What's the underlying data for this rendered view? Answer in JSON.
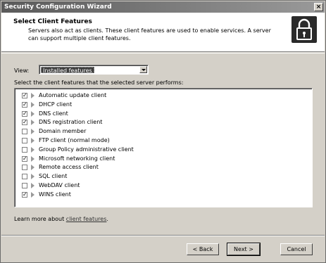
{
  "window": {
    "title": "Security Configuration Wizard",
    "close_label": "×"
  },
  "header": {
    "title": "Select Client Features",
    "description": "Servers also act as clients. These client features are used to enable services. A server can support multiple client features."
  },
  "view": {
    "label": "View:",
    "selected": "Installed features"
  },
  "list": {
    "caption": "Select the client features that the selected server performs:",
    "items": [
      {
        "label": "Automatic update client",
        "checked": true
      },
      {
        "label": "DHCP client",
        "checked": true
      },
      {
        "label": "DNS client",
        "checked": true
      },
      {
        "label": "DNS registration client",
        "checked": true
      },
      {
        "label": "Domain member",
        "checked": false
      },
      {
        "label": "FTP client (normal mode)",
        "checked": false
      },
      {
        "label": "Group Policy administrative client",
        "checked": false
      },
      {
        "label": "Microsoft networking client",
        "checked": true
      },
      {
        "label": "Remote access client",
        "checked": false
      },
      {
        "label": "SQL client",
        "checked": false
      },
      {
        "label": "WebDAV client",
        "checked": false
      },
      {
        "label": "WINS client",
        "checked": true
      }
    ]
  },
  "learn_more": {
    "prefix": "Learn more about ",
    "link": "client features",
    "suffix": "."
  },
  "buttons": {
    "back": "< Back",
    "next": "Next >",
    "cancel": "Cancel"
  }
}
